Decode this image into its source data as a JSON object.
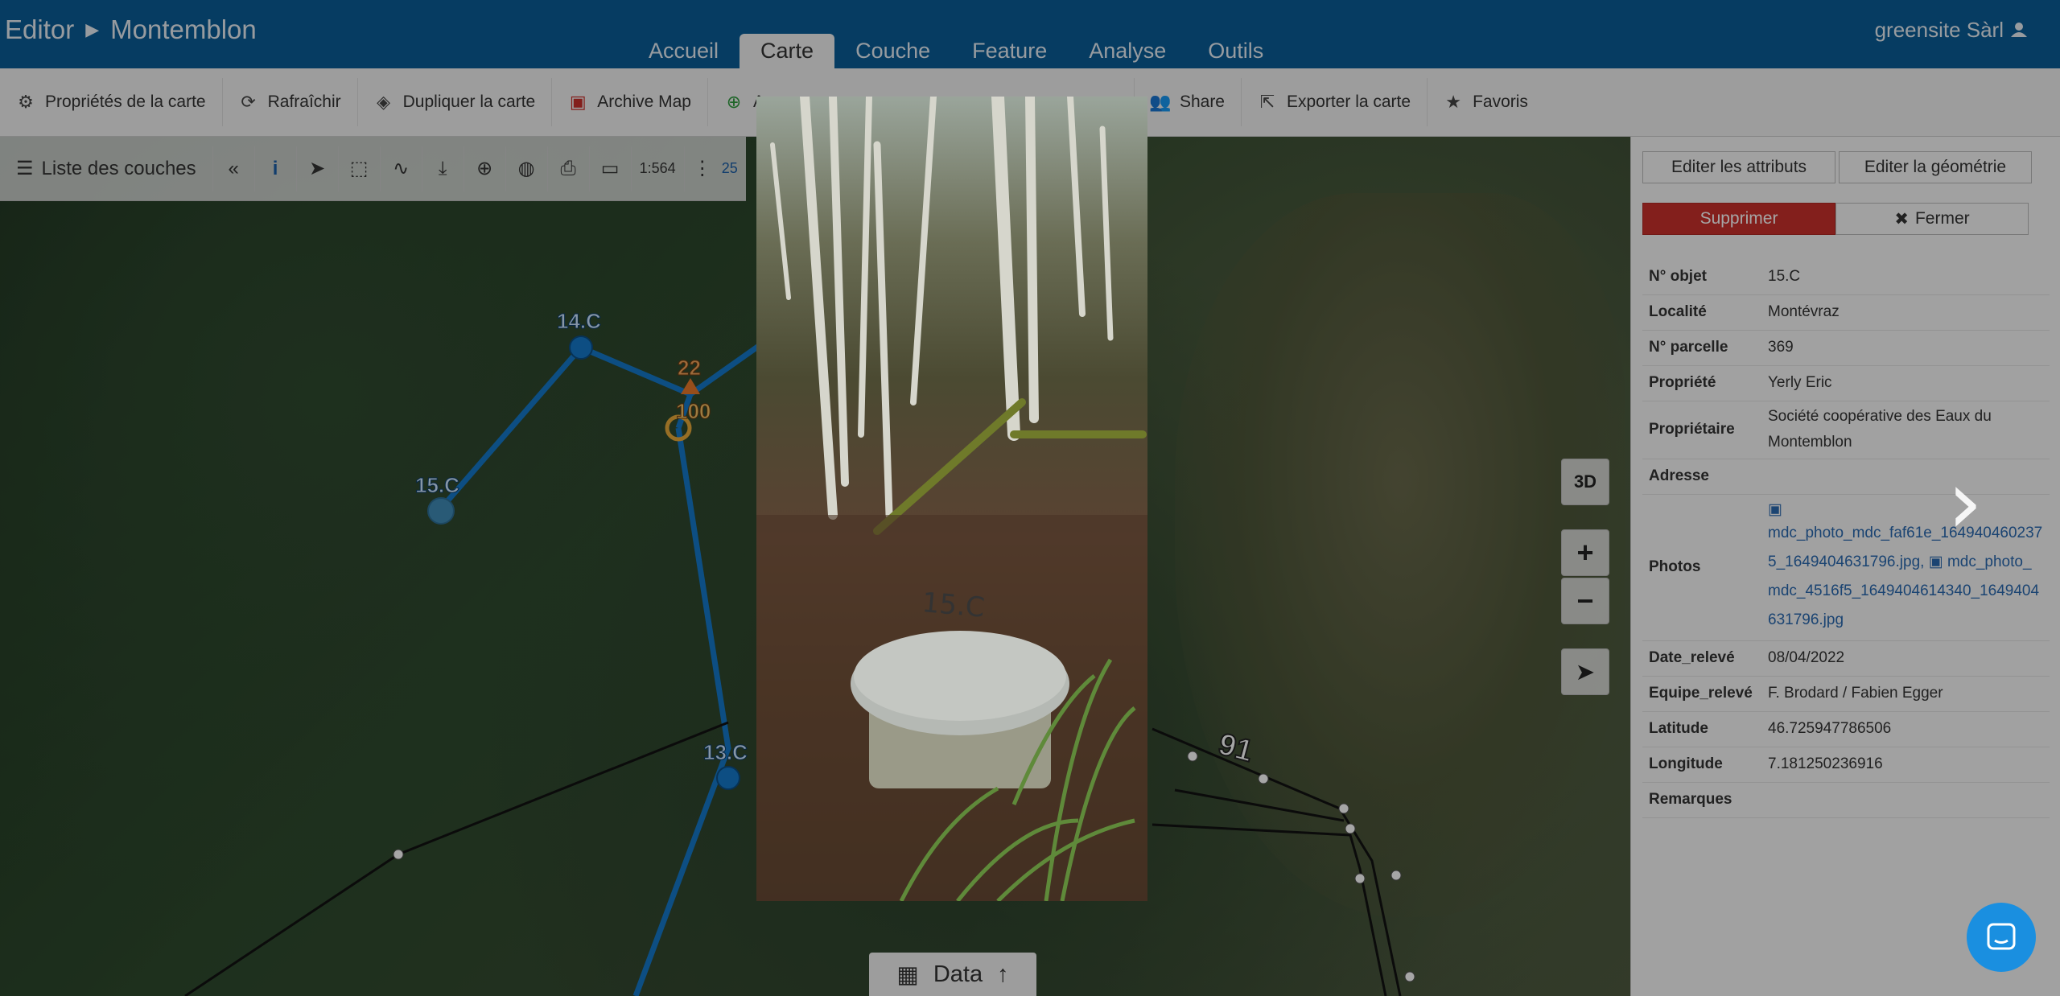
{
  "header": {
    "app": "Editor",
    "project": "Montemblon",
    "tabs": [
      "Accueil",
      "Carte",
      "Couche",
      "Feature",
      "Analyse",
      "Outils"
    ],
    "active_tab": "Carte",
    "user": "greensite Sàrl"
  },
  "toolbar": {
    "map_props": "Propriétés de la carte",
    "refresh": "Rafraîchir",
    "duplicate": "Dupliquer la carte",
    "archive": "Archive Map",
    "add_partial": "A",
    "share": "Share",
    "export": "Exporter la carte",
    "favorites": "Favoris"
  },
  "map_toolbar": {
    "layers": "Liste des couches",
    "scale": "1:564",
    "extra": "25"
  },
  "map": {
    "labels": {
      "n14": "14.C",
      "n15": "15.C",
      "n13": "13.C",
      "v22": "22",
      "v100": "100",
      "v91": "91"
    },
    "btn_3d": "3D",
    "zoom_in": "+",
    "zoom_out": "−"
  },
  "data_button": "Data",
  "photo": {
    "label": "15.C"
  },
  "panel": {
    "edit_attrs": "Editer les attributs",
    "edit_geom": "Editer la géométrie",
    "delete": "Supprimer",
    "close": "Fermer",
    "rows": [
      {
        "k": "N° objet",
        "v": "15.C"
      },
      {
        "k": "Localité",
        "v": "Montévraz"
      },
      {
        "k": "N° parcelle",
        "v": "369"
      },
      {
        "k": "Propriété",
        "v": "Yerly Eric"
      },
      {
        "k": "Propriétaire",
        "v": "Société coopérative des Eaux du Montemblon"
      },
      {
        "k": "Adresse",
        "v": ""
      },
      {
        "k": "Photos",
        "v": ""
      },
      {
        "k": "Date_relevé",
        "v": "08/04/2022"
      },
      {
        "k": "Equipe_relevé",
        "v": "F. Brodard / Fabien Egger"
      },
      {
        "k": "Latitude",
        "v": "46.725947786506"
      },
      {
        "k": "Longitude",
        "v": "7.181250236916"
      },
      {
        "k": "Remarques",
        "v": ""
      }
    ],
    "photo1": "mdc_photo_mdc_faf61e_1649404602375_1649404631796.jpg,",
    "photo2": "mdc_photo_mdc_4516f5_1649404614340_1649404631796.jpg"
  },
  "colors": {
    "header": "#0a5d97",
    "danger": "#c9302c",
    "network": "#1479c9",
    "link": "#2a69b0"
  }
}
